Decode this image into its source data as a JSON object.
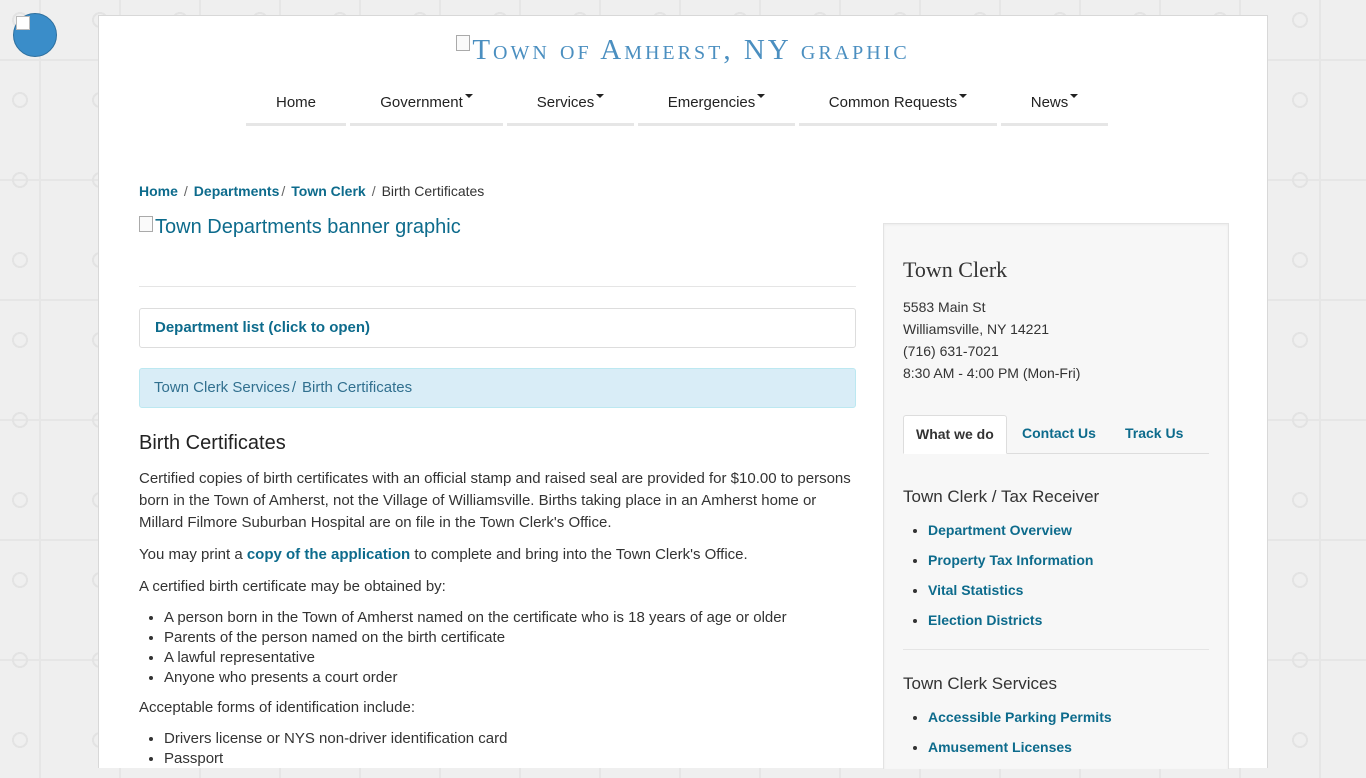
{
  "header": {
    "logo_alt": "Town of Amherst, NY graphic"
  },
  "nav": [
    {
      "label": "Home",
      "dropdown": false
    },
    {
      "label": "Government",
      "dropdown": true
    },
    {
      "label": "Services",
      "dropdown": true
    },
    {
      "label": "Emergencies",
      "dropdown": true
    },
    {
      "label": "Common Requests",
      "dropdown": true
    },
    {
      "label": "News",
      "dropdown": true
    }
  ],
  "breadcrumb": {
    "home": "Home",
    "departments": "Departments",
    "town_clerk": "Town Clerk",
    "current": "Birth Certificates"
  },
  "banner_alt": "Town Departments banner graphic",
  "dept_list_label": "Department list (click to open)",
  "info_crumb": {
    "parent": "Town Clerk Services",
    "current": "Birth Certificates"
  },
  "content": {
    "title": "Birth Certificates",
    "para1": "Certified copies of birth certificates with an official stamp and raised seal are provided for $10.00 to persons born in the Town of Amherst, not the Village of Williamsville. Births taking place in an Amherst home or Millard Filmore Suburban Hospital are on file in the Town Clerk's Office.",
    "para2_pre": "You may print a ",
    "para2_link": "copy of the application",
    "para2_post": " to complete and bring into the Town Clerk's Office.",
    "para3": "A certified birth certificate may be obtained by:",
    "eligible": [
      "A person born in the Town of Amherst named on the certificate who is 18 years of age or older",
      "Parents of the person named on the birth certificate",
      "A lawful representative",
      "Anyone who presents a court order"
    ],
    "para4": "Acceptable forms of identification include:",
    "ids": [
      "Drivers license or NYS non-driver identification card",
      "Passport"
    ]
  },
  "sidebar": {
    "title": "Town Clerk",
    "address1": "5583 Main St",
    "address2": "Williamsville, NY  14221",
    "phone": "(716) 631-7021",
    "hours": "8:30 AM - 4:00 PM (Mon-Fri)",
    "tabs": [
      "What we do",
      "Contact Us",
      "Track Us"
    ],
    "section1_title": "Town Clerk / Tax Receiver",
    "section1_links": [
      "Department Overview",
      "Property Tax Information",
      "Vital Statistics",
      "Election Districts"
    ],
    "section2_title": "Town Clerk Services",
    "section2_links": [
      "Accessible Parking Permits",
      "Amusement Licenses"
    ]
  },
  "colors": {
    "link": "#0d6b8c",
    "info_bg": "#d9edf7",
    "info_text": "#31708f",
    "logo_text": "#4b8fc0",
    "access_button": "#3a8dc9"
  }
}
